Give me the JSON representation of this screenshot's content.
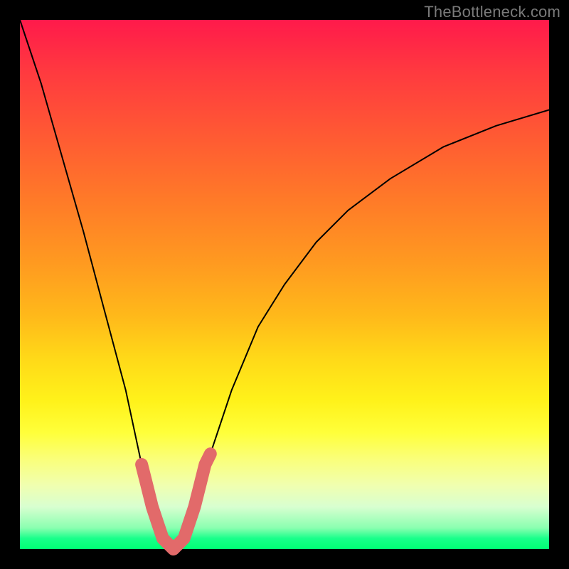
{
  "watermark": {
    "text": "TheBottleneck.com"
  },
  "chart_data": {
    "type": "line",
    "title": "",
    "xlabel": "",
    "ylabel": "",
    "xlim": [
      0,
      100
    ],
    "ylim": [
      0,
      100
    ],
    "grid": false,
    "series": [
      {
        "name": "bottleneck-curve",
        "x": [
          0,
          4,
          8,
          12,
          16,
          20,
          23,
          25,
          27,
          29,
          31,
          33,
          36,
          40,
          45,
          50,
          56,
          62,
          70,
          80,
          90,
          100
        ],
        "values": [
          100,
          88,
          74,
          60,
          45,
          30,
          16,
          8,
          2,
          0,
          2,
          8,
          18,
          30,
          42,
          50,
          58,
          64,
          70,
          76,
          80,
          83
        ]
      },
      {
        "name": "bottom-highlight",
        "x": [
          23,
          24,
          25,
          26,
          27,
          28,
          29,
          30,
          31,
          32,
          33,
          34,
          35,
          36
        ],
        "values": [
          16,
          12,
          8,
          5,
          2,
          1,
          0,
          1,
          2,
          5,
          8,
          12,
          16,
          18
        ]
      }
    ],
    "background_gradient": {
      "top": "#ff1a4b",
      "mid": "#ffd918",
      "bottom": "#00ff74"
    },
    "highlight_color": "#e26a6a",
    "curve_color": "#000000"
  }
}
